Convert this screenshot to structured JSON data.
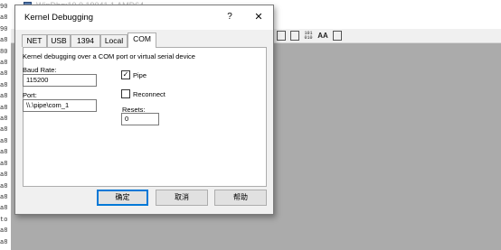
{
  "background_window": {
    "title": "WinDbg:10.0.19041.1 AMD64",
    "menu_first": "Fi",
    "left_lines": [
      "90",
      "a8",
      "90",
      "a8",
      "80",
      "a8",
      "a8",
      "a8",
      "a8",
      "a8",
      "a8",
      "a8",
      "a8",
      "a8",
      "a8",
      "a8",
      "a8",
      "a8",
      "a8",
      "to",
      "a8",
      "a8"
    ],
    "toolbar_icons": [
      "memory-window-icon",
      "locals-window-icon",
      "registers-window-icon",
      "font-icon",
      "options-icon"
    ],
    "toolbar_glyphs": {
      "b3": "101\n010",
      "b4": "AA"
    }
  },
  "dialog": {
    "title": "Kernel Debugging",
    "help_glyph": "?",
    "close_glyph": "✕",
    "tabs": [
      {
        "label": "NET",
        "active": false
      },
      {
        "label": "USB",
        "active": false
      },
      {
        "label": "1394",
        "active": false
      },
      {
        "label": "Local",
        "active": false
      },
      {
        "label": "COM",
        "active": true
      }
    ],
    "description": "Kernel debugging over a COM port or virtual serial device",
    "baud_rate": {
      "label": "Baud Rate:",
      "value": "115200"
    },
    "port": {
      "label": "Port:",
      "value": "\\\\.\\pipe\\com_1"
    },
    "pipe": {
      "label": "Pipe",
      "checked": true
    },
    "reconnect": {
      "label": "Reconnect",
      "checked": false
    },
    "resets": {
      "label": "Resets:",
      "value": "0"
    },
    "buttons": {
      "ok": "确定",
      "cancel": "取消",
      "help": "帮助"
    }
  },
  "colors": {
    "accent": "#0078d7",
    "client_background": "#ababab",
    "dialog_face": "#f0f0f0"
  }
}
